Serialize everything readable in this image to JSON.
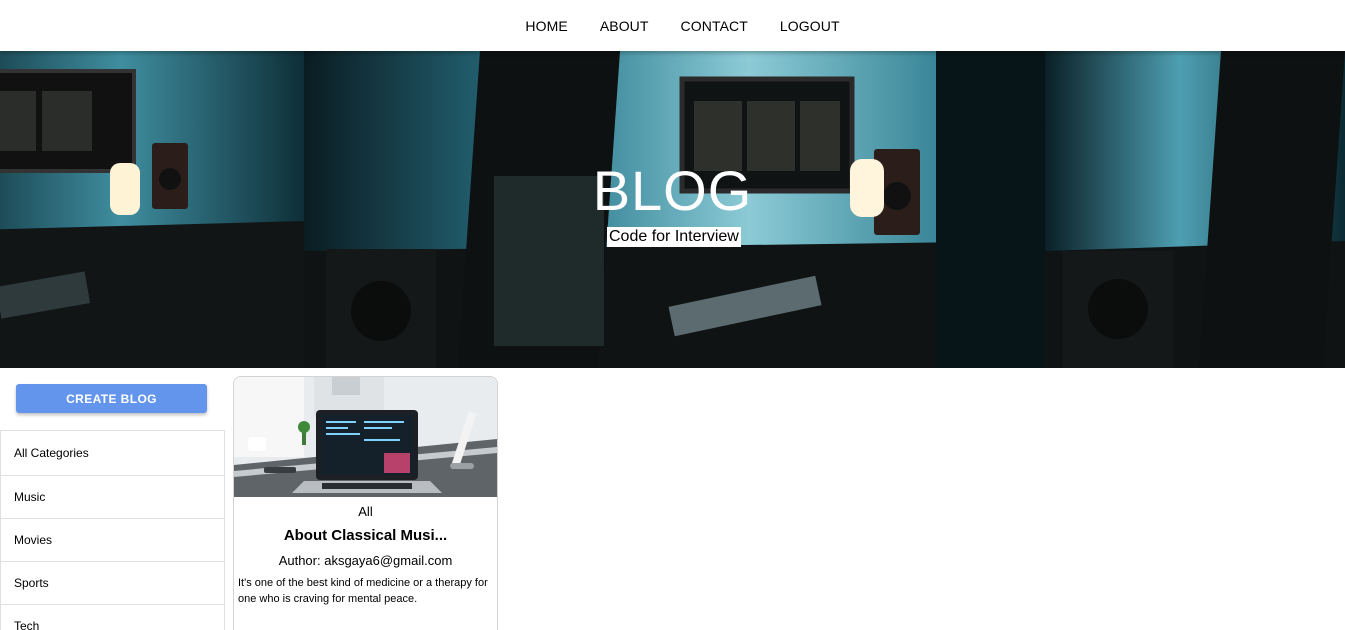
{
  "nav": {
    "items": [
      {
        "label": "HOME"
      },
      {
        "label": "ABOUT"
      },
      {
        "label": "CONTACT"
      },
      {
        "label": "LOGOUT"
      }
    ]
  },
  "hero": {
    "title": "BLOG",
    "subtitle": "Code for Interview",
    "image_desc": "desk with monitors and speakers, teal lighting"
  },
  "sidebar": {
    "create_label": "CREATE BLOG",
    "categories": [
      {
        "label": "All Categories"
      },
      {
        "label": "Music"
      },
      {
        "label": "Movies"
      },
      {
        "label": "Sports"
      },
      {
        "label": "Tech"
      }
    ]
  },
  "posts": [
    {
      "category": "All",
      "title": "About Classical Musi...",
      "author": "Author: aksgaya6@gmail.com",
      "description": "It's one of the best kind of medicine or a therapy for one who is craving for mental peace."
    }
  ],
  "colors": {
    "accent": "#6495ed",
    "hero_bg": "#061419"
  }
}
